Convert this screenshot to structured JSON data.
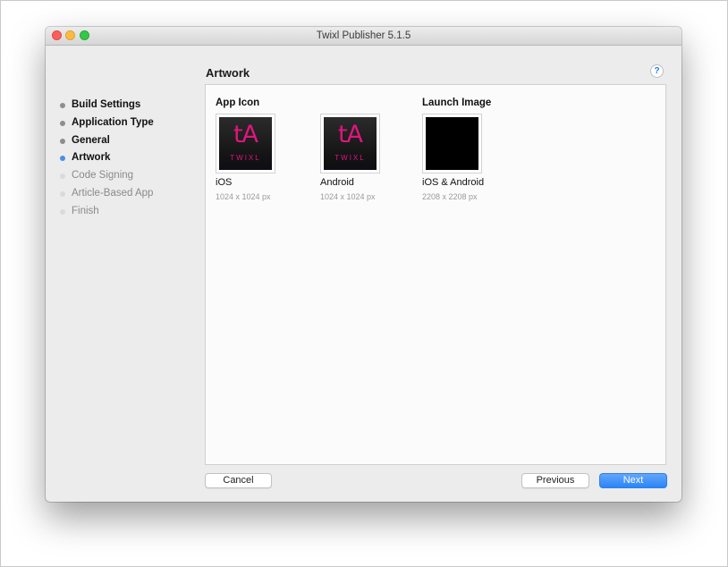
{
  "window": {
    "title": "Twixl Publisher 5.1.5"
  },
  "header": {
    "heading": "Artwork",
    "help_label": "?"
  },
  "sidebar": {
    "steps": [
      {
        "label": "Build Settings",
        "state": "done"
      },
      {
        "label": "Application Type",
        "state": "done"
      },
      {
        "label": "General",
        "state": "done"
      },
      {
        "label": "Artwork",
        "state": "current"
      },
      {
        "label": "Code Signing",
        "state": "todo"
      },
      {
        "label": "Article-Based App",
        "state": "todo"
      },
      {
        "label": "Finish",
        "state": "todo"
      }
    ]
  },
  "main": {
    "app_icon_title": "App Icon",
    "launch_image_title": "Launch Image",
    "artwork": [
      {
        "label": "iOS",
        "size": "1024 x 1024 px",
        "icon_text": "tA",
        "icon_brand": "TWIXL"
      },
      {
        "label": "Android",
        "size": "1024 x 1024 px",
        "icon_text": "tA",
        "icon_brand": "TWIXL"
      },
      {
        "label": "iOS & Android",
        "size": "2208 x 2208 px"
      }
    ]
  },
  "footer": {
    "cancel_label": "Cancel",
    "previous_label": "Previous",
    "next_label": "Next"
  },
  "colors": {
    "accent": "#2a85f8",
    "brand_pink": "#e0157d",
    "current_step_dot": "#4a8fe7"
  }
}
